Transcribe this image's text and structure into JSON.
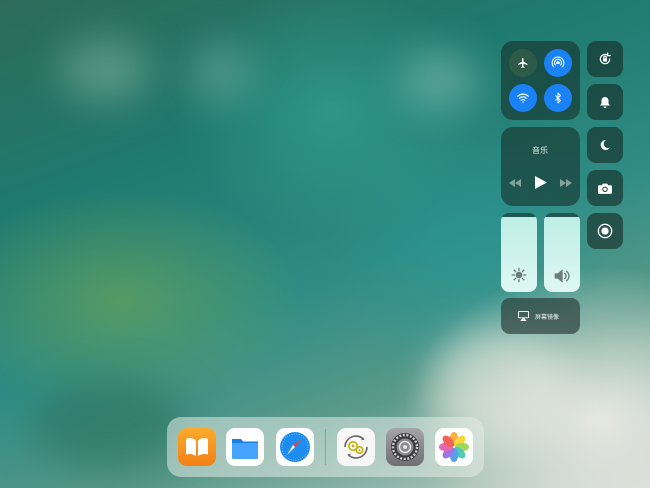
{
  "control_center": {
    "connectivity": {
      "airplane_mode": {
        "icon": "airplane-icon",
        "active": false
      },
      "airdrop": {
        "icon": "airdrop-icon",
        "active": true
      },
      "wifi": {
        "icon": "wifi-icon",
        "active": true
      },
      "bluetooth": {
        "icon": "bluetooth-icon",
        "active": true
      }
    },
    "music": {
      "title": "音乐",
      "controls": [
        "rewind-icon",
        "play-icon",
        "fast-forward-icon"
      ]
    },
    "brightness": {
      "icon": "sun-icon",
      "level": 0.95
    },
    "volume": {
      "icon": "speaker-icon",
      "level": 0.95
    },
    "screen_mirroring": {
      "label": "屏幕镜像",
      "icon": "screen-mirroring-icon"
    },
    "toggles": [
      {
        "name": "orientation-lock",
        "icon": "orientation-lock-icon"
      },
      {
        "name": "silent",
        "icon": "bell-icon"
      },
      {
        "name": "do-not-disturb",
        "icon": "moon-icon"
      },
      {
        "name": "camera",
        "icon": "camera-icon"
      },
      {
        "name": "screen-recording",
        "icon": "screen-record-icon"
      }
    ]
  },
  "dock": {
    "apps": [
      {
        "name": "books",
        "icon": "books-icon",
        "color": "#f89a1e"
      },
      {
        "name": "files",
        "icon": "files-icon",
        "color": "#1d8cf3"
      },
      {
        "name": "safari",
        "icon": "safari-icon",
        "color": "#1f8cf0"
      },
      {
        "name": "unknown-app",
        "icon": "gears-cycle-icon",
        "color": "#f4f4f4"
      },
      {
        "name": "settings",
        "icon": "settings-gear-icon",
        "color": "#8e8e93"
      },
      {
        "name": "photos",
        "icon": "photos-icon",
        "color": "#ffffff"
      }
    ]
  },
  "colors": {
    "accent_blue": "#1a82f7",
    "airplane_off": "#2e5a48",
    "slider_fill": "#cdf3ec"
  }
}
